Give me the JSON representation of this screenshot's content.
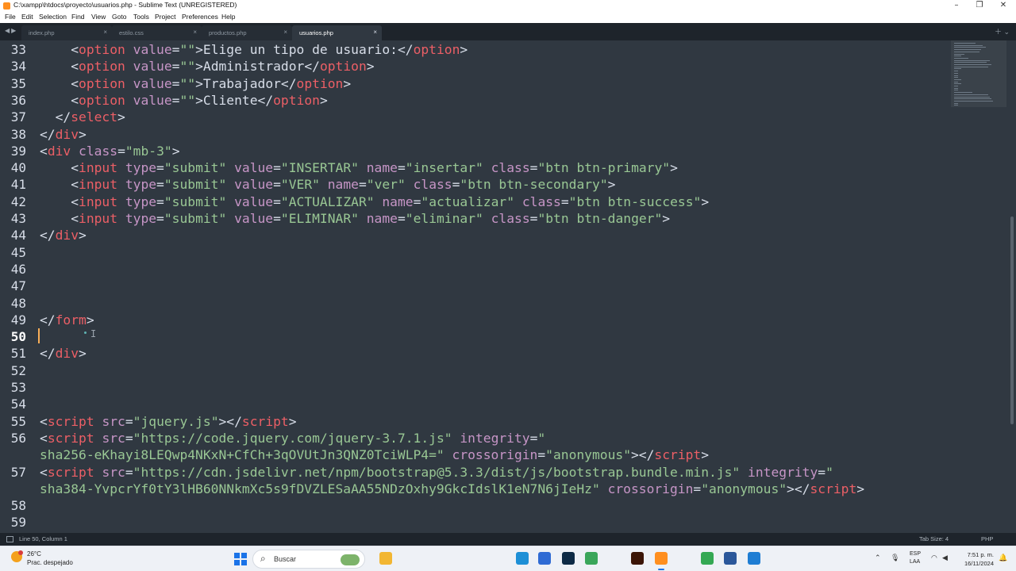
{
  "window": {
    "title": "C:\\xampp\\htdocs\\proyecto\\usuarios.php - Sublime Text (UNREGISTERED)",
    "controls": [
      "–",
      "❐",
      "✕"
    ]
  },
  "menu": [
    "File",
    "Edit",
    "Selection",
    "Find",
    "View",
    "Goto",
    "Tools",
    "Project",
    "Preferences",
    "Help"
  ],
  "tabs": [
    {
      "label": "index.php",
      "active": false
    },
    {
      "label": "estilo.css",
      "active": false
    },
    {
      "label": "productos.php",
      "active": false
    },
    {
      "label": "usuarios.php",
      "active": true
    }
  ],
  "editor": {
    "current_line": "50",
    "lines": [
      {
        "n": "33",
        "cur": false,
        "tokens": [
          {
            "c": "p",
            "t": "    <"
          },
          {
            "c": "t",
            "t": "option"
          },
          {
            "c": "a",
            "t": " value"
          },
          {
            "c": "p",
            "t": "="
          },
          {
            "c": "s",
            "t": "\"\""
          },
          {
            "c": "p",
            "t": ">Elige un tipo de usuario:</"
          },
          {
            "c": "t",
            "t": "option"
          },
          {
            "c": "p",
            "t": ">"
          }
        ]
      },
      {
        "n": "34",
        "cur": false,
        "tokens": [
          {
            "c": "p",
            "t": "    <"
          },
          {
            "c": "t",
            "t": "option"
          },
          {
            "c": "a",
            "t": " value"
          },
          {
            "c": "p",
            "t": "="
          },
          {
            "c": "s",
            "t": "\"\""
          },
          {
            "c": "p",
            "t": ">Administrador</"
          },
          {
            "c": "t",
            "t": "option"
          },
          {
            "c": "p",
            "t": ">"
          }
        ]
      },
      {
        "n": "35",
        "cur": false,
        "tokens": [
          {
            "c": "p",
            "t": "    <"
          },
          {
            "c": "t",
            "t": "option"
          },
          {
            "c": "a",
            "t": " value"
          },
          {
            "c": "p",
            "t": "="
          },
          {
            "c": "s",
            "t": "\"\""
          },
          {
            "c": "p",
            "t": ">Trabajador</"
          },
          {
            "c": "t",
            "t": "option"
          },
          {
            "c": "p",
            "t": ">"
          }
        ]
      },
      {
        "n": "36",
        "cur": false,
        "tokens": [
          {
            "c": "p",
            "t": "    <"
          },
          {
            "c": "t",
            "t": "option"
          },
          {
            "c": "a",
            "t": " value"
          },
          {
            "c": "p",
            "t": "="
          },
          {
            "c": "s",
            "t": "\"\""
          },
          {
            "c": "p",
            "t": ">Cliente</"
          },
          {
            "c": "t",
            "t": "option"
          },
          {
            "c": "p",
            "t": ">"
          }
        ]
      },
      {
        "n": "37",
        "cur": false,
        "tokens": [
          {
            "c": "p",
            "t": "  </"
          },
          {
            "c": "t",
            "t": "select"
          },
          {
            "c": "p",
            "t": ">"
          }
        ]
      },
      {
        "n": "38",
        "cur": false,
        "tokens": [
          {
            "c": "p",
            "t": "</"
          },
          {
            "c": "t",
            "t": "div"
          },
          {
            "c": "p",
            "t": ">"
          }
        ]
      },
      {
        "n": "39",
        "cur": false,
        "tokens": [
          {
            "c": "p",
            "t": "<"
          },
          {
            "c": "t",
            "t": "div"
          },
          {
            "c": "a",
            "t": " class"
          },
          {
            "c": "p",
            "t": "="
          },
          {
            "c": "s",
            "t": "\"mb-3\""
          },
          {
            "c": "p",
            "t": ">"
          }
        ]
      },
      {
        "n": "40",
        "cur": false,
        "tokens": [
          {
            "c": "p",
            "t": "    <"
          },
          {
            "c": "t",
            "t": "input"
          },
          {
            "c": "a",
            "t": " type"
          },
          {
            "c": "p",
            "t": "="
          },
          {
            "c": "s",
            "t": "\"submit\""
          },
          {
            "c": "a",
            "t": " value"
          },
          {
            "c": "p",
            "t": "="
          },
          {
            "c": "s",
            "t": "\"INSERTAR\""
          },
          {
            "c": "a",
            "t": " name"
          },
          {
            "c": "p",
            "t": "="
          },
          {
            "c": "s",
            "t": "\"insertar\""
          },
          {
            "c": "a",
            "t": " class"
          },
          {
            "c": "p",
            "t": "="
          },
          {
            "c": "s",
            "t": "\"btn btn-primary\""
          },
          {
            "c": "p",
            "t": ">"
          }
        ]
      },
      {
        "n": "41",
        "cur": false,
        "tokens": [
          {
            "c": "p",
            "t": "    <"
          },
          {
            "c": "t",
            "t": "input"
          },
          {
            "c": "a",
            "t": " type"
          },
          {
            "c": "p",
            "t": "="
          },
          {
            "c": "s",
            "t": "\"submit\""
          },
          {
            "c": "a",
            "t": " value"
          },
          {
            "c": "p",
            "t": "="
          },
          {
            "c": "s",
            "t": "\"VER\""
          },
          {
            "c": "a",
            "t": " name"
          },
          {
            "c": "p",
            "t": "="
          },
          {
            "c": "s",
            "t": "\"ver\""
          },
          {
            "c": "a",
            "t": " class"
          },
          {
            "c": "p",
            "t": "="
          },
          {
            "c": "s",
            "t": "\"btn btn-secondary\""
          },
          {
            "c": "p",
            "t": ">"
          }
        ]
      },
      {
        "n": "42",
        "cur": false,
        "tokens": [
          {
            "c": "p",
            "t": "    <"
          },
          {
            "c": "t",
            "t": "input"
          },
          {
            "c": "a",
            "t": " type"
          },
          {
            "c": "p",
            "t": "="
          },
          {
            "c": "s",
            "t": "\"submit\""
          },
          {
            "c": "a",
            "t": " value"
          },
          {
            "c": "p",
            "t": "="
          },
          {
            "c": "s",
            "t": "\"ACTUALIZAR\""
          },
          {
            "c": "a",
            "t": " name"
          },
          {
            "c": "p",
            "t": "="
          },
          {
            "c": "s",
            "t": "\"actualizar\""
          },
          {
            "c": "a",
            "t": " class"
          },
          {
            "c": "p",
            "t": "="
          },
          {
            "c": "s",
            "t": "\"btn btn-success\""
          },
          {
            "c": "p",
            "t": ">"
          }
        ]
      },
      {
        "n": "43",
        "cur": false,
        "tokens": [
          {
            "c": "p",
            "t": "    <"
          },
          {
            "c": "t",
            "t": "input"
          },
          {
            "c": "a",
            "t": " type"
          },
          {
            "c": "p",
            "t": "="
          },
          {
            "c": "s",
            "t": "\"submit\""
          },
          {
            "c": "a",
            "t": " value"
          },
          {
            "c": "p",
            "t": "="
          },
          {
            "c": "s",
            "t": "\"ELIMINAR\""
          },
          {
            "c": "a",
            "t": " name"
          },
          {
            "c": "p",
            "t": "="
          },
          {
            "c": "s",
            "t": "\"eliminar\""
          },
          {
            "c": "a",
            "t": " class"
          },
          {
            "c": "p",
            "t": "="
          },
          {
            "c": "s",
            "t": "\"btn btn-danger\""
          },
          {
            "c": "p",
            "t": ">"
          }
        ]
      },
      {
        "n": "44",
        "cur": false,
        "tokens": [
          {
            "c": "p",
            "t": "</"
          },
          {
            "c": "t",
            "t": "div"
          },
          {
            "c": "p",
            "t": ">"
          }
        ]
      },
      {
        "n": "45",
        "cur": false,
        "tokens": []
      },
      {
        "n": "46",
        "cur": false,
        "tokens": []
      },
      {
        "n": "47",
        "cur": false,
        "tokens": []
      },
      {
        "n": "48",
        "cur": false,
        "tokens": []
      },
      {
        "n": "49",
        "cur": false,
        "tokens": [
          {
            "c": "p",
            "t": "</"
          },
          {
            "c": "t",
            "t": "form"
          },
          {
            "c": "p",
            "t": ">"
          }
        ]
      },
      {
        "n": "50",
        "cur": true,
        "tokens": []
      },
      {
        "n": "51",
        "cur": false,
        "tokens": [
          {
            "c": "p",
            "t": "</"
          },
          {
            "c": "t",
            "t": "div"
          },
          {
            "c": "p",
            "t": ">"
          }
        ]
      },
      {
        "n": "52",
        "cur": false,
        "tokens": []
      },
      {
        "n": "53",
        "cur": false,
        "tokens": []
      },
      {
        "n": "54",
        "cur": false,
        "tokens": []
      },
      {
        "n": "55",
        "cur": false,
        "tokens": [
          {
            "c": "p",
            "t": "<"
          },
          {
            "c": "t",
            "t": "script"
          },
          {
            "c": "a",
            "t": " src"
          },
          {
            "c": "p",
            "t": "="
          },
          {
            "c": "s",
            "t": "\"jquery.js\""
          },
          {
            "c": "p",
            "t": "></"
          },
          {
            "c": "t",
            "t": "script"
          },
          {
            "c": "p",
            "t": ">"
          }
        ]
      },
      {
        "n": "56",
        "cur": false,
        "tokens": [
          {
            "c": "p",
            "t": "<"
          },
          {
            "c": "t",
            "t": "script"
          },
          {
            "c": "a",
            "t": " src"
          },
          {
            "c": "p",
            "t": "="
          },
          {
            "c": "s",
            "t": "\"https://code.jquery.com/jquery-3.7.1.js\""
          },
          {
            "c": "a",
            "t": " integrity"
          },
          {
            "c": "p",
            "t": "="
          },
          {
            "c": "s",
            "t": "\""
          }
        ]
      },
      {
        "n": "",
        "cur": false,
        "tokens": [
          {
            "c": "s",
            "t": "sha256-eKhayi8LEQwp4NKxN+CfCh+3qOVUtJn3QNZ0TciWLP4=\""
          },
          {
            "c": "a",
            "t": " crossorigin"
          },
          {
            "c": "p",
            "t": "="
          },
          {
            "c": "s",
            "t": "\"anonymous\""
          },
          {
            "c": "p",
            "t": "></"
          },
          {
            "c": "t",
            "t": "script"
          },
          {
            "c": "p",
            "t": ">"
          }
        ]
      },
      {
        "n": "57",
        "cur": false,
        "tokens": [
          {
            "c": "p",
            "t": "<"
          },
          {
            "c": "t",
            "t": "script"
          },
          {
            "c": "a",
            "t": " src"
          },
          {
            "c": "p",
            "t": "="
          },
          {
            "c": "s",
            "t": "\"https://cdn.jsdelivr.net/npm/bootstrap@5.3.3/dist/js/bootstrap.bundle.min.js\""
          },
          {
            "c": "a",
            "t": " integrity"
          },
          {
            "c": "p",
            "t": "="
          },
          {
            "c": "s",
            "t": "\""
          }
        ]
      },
      {
        "n": "",
        "cur": false,
        "tokens": [
          {
            "c": "s",
            "t": "sha384-YvpcrYf0tY3lHB60NNkmXc5s9fDVZLESaAA55NDzOxhy9GkcIdslK1eN7N6jIeHz\""
          },
          {
            "c": "a",
            "t": " crossorigin"
          },
          {
            "c": "p",
            "t": "="
          },
          {
            "c": "s",
            "t": "\"anonymous\""
          },
          {
            "c": "p",
            "t": "></"
          },
          {
            "c": "t",
            "t": "script"
          },
          {
            "c": "p",
            "t": ">"
          }
        ]
      },
      {
        "n": "58",
        "cur": false,
        "tokens": []
      },
      {
        "n": "59",
        "cur": false,
        "tokens": []
      }
    ]
  },
  "statusbar": {
    "position": "Line 50, Column 1",
    "tab_size": "Tab Size: 4",
    "syntax": "PHP"
  },
  "taskbar": {
    "weather_temp": "26°C",
    "weather_desc": "Prac. despejado",
    "search_placeholder": "Buscar",
    "lang_1": "ESP",
    "lang_2": "LAA",
    "time": "7:51 p. m.",
    "date": "16/11/2024",
    "apps": [
      {
        "name": "file-explorer-app",
        "color": "#f2b632"
      },
      {
        "name": "edge-app",
        "color": "#1d8fd6"
      },
      {
        "name": "store-app",
        "color": "#2f6bd4"
      },
      {
        "name": "photoshop-app",
        "color": "#0d2a45"
      },
      {
        "name": "browser-app",
        "color": "#3aa65a"
      },
      {
        "name": "illustrator-app",
        "color": "#3b1506"
      },
      {
        "name": "sublime-app",
        "color": "#ff8f1f"
      },
      {
        "name": "chrome-app",
        "color": "#34a853"
      },
      {
        "name": "word-app",
        "color": "#2b579a"
      },
      {
        "name": "vscode-app",
        "color": "#1e7dd3"
      }
    ]
  }
}
